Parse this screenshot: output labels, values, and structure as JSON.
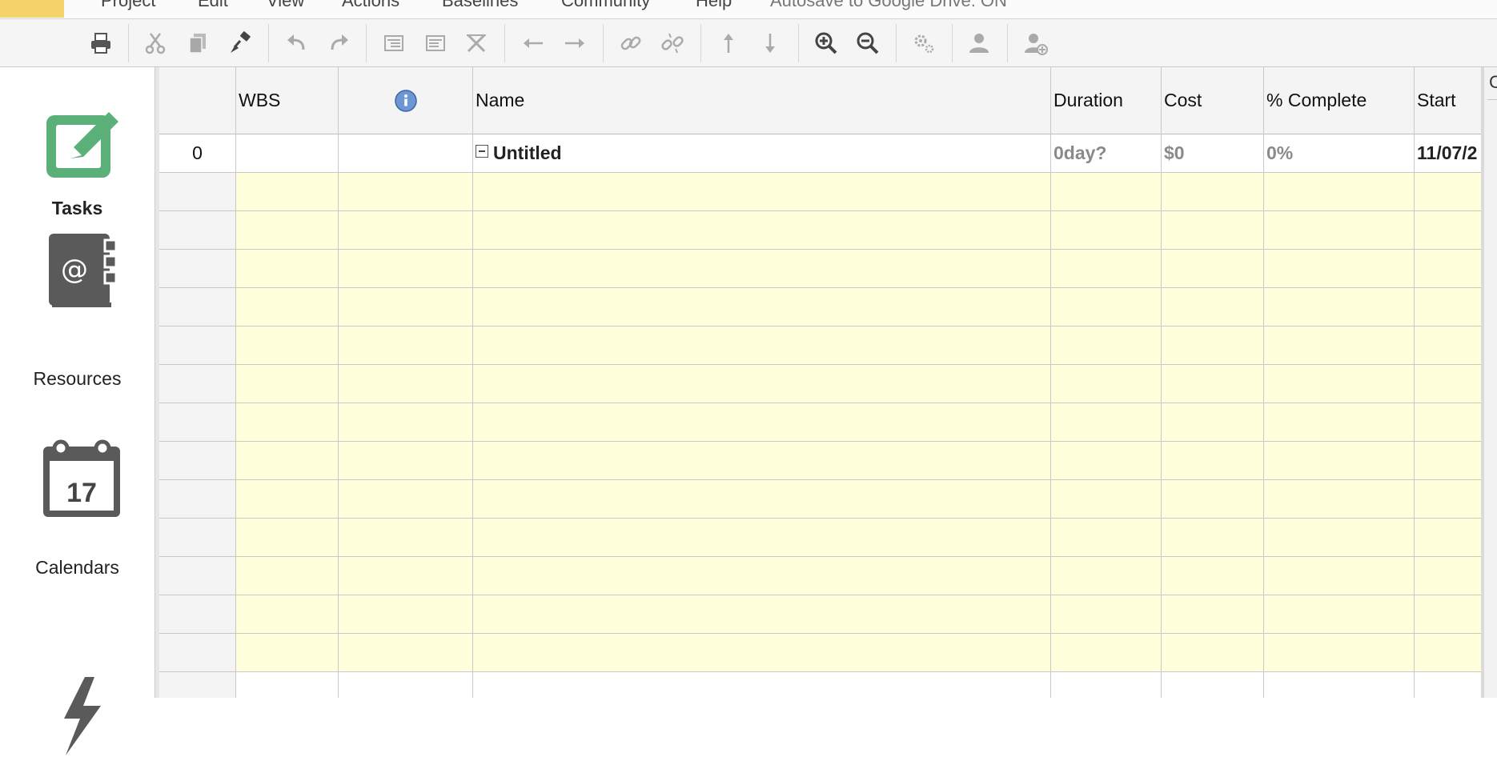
{
  "menu": {
    "items": [
      "Project",
      "Edit",
      "View",
      "Actions",
      "Baselines",
      "Community",
      "Help"
    ],
    "autosave": "Autosave to Google Drive: ON"
  },
  "toolbar": {
    "buttons": [
      "print-icon",
      "cut-icon",
      "copy-icon",
      "paste-format-icon",
      "undo-icon",
      "redo-icon",
      "indent-icon",
      "outdent-icon",
      "delete-task-icon",
      "move-left-icon",
      "move-right-icon",
      "link-icon",
      "unlink-icon",
      "move-up-icon",
      "move-down-icon",
      "zoom-in-icon",
      "zoom-out-icon",
      "settings-icon",
      "user-icon",
      "add-user-icon"
    ]
  },
  "nav": {
    "tasks": "Tasks",
    "resources": "Resources",
    "calendars": "Calendars",
    "calendar_day": "17"
  },
  "grid": {
    "columns": {
      "wbs": "WBS",
      "name": "Name",
      "duration": "Duration",
      "cost": "Cost",
      "complete": "% Complete",
      "start": "Start"
    },
    "root": {
      "id": "0",
      "name": "Untitled",
      "duration": "0day?",
      "cost": "$0",
      "complete": "0%",
      "start": "11/07/2"
    }
  },
  "right_edge": {
    "letter": "C"
  },
  "colors": {
    "row_fill": "#ffffdb",
    "header": "#f4f4f4",
    "tasks_accent": "#5bb079",
    "icon_dark": "#5a5a5a"
  }
}
